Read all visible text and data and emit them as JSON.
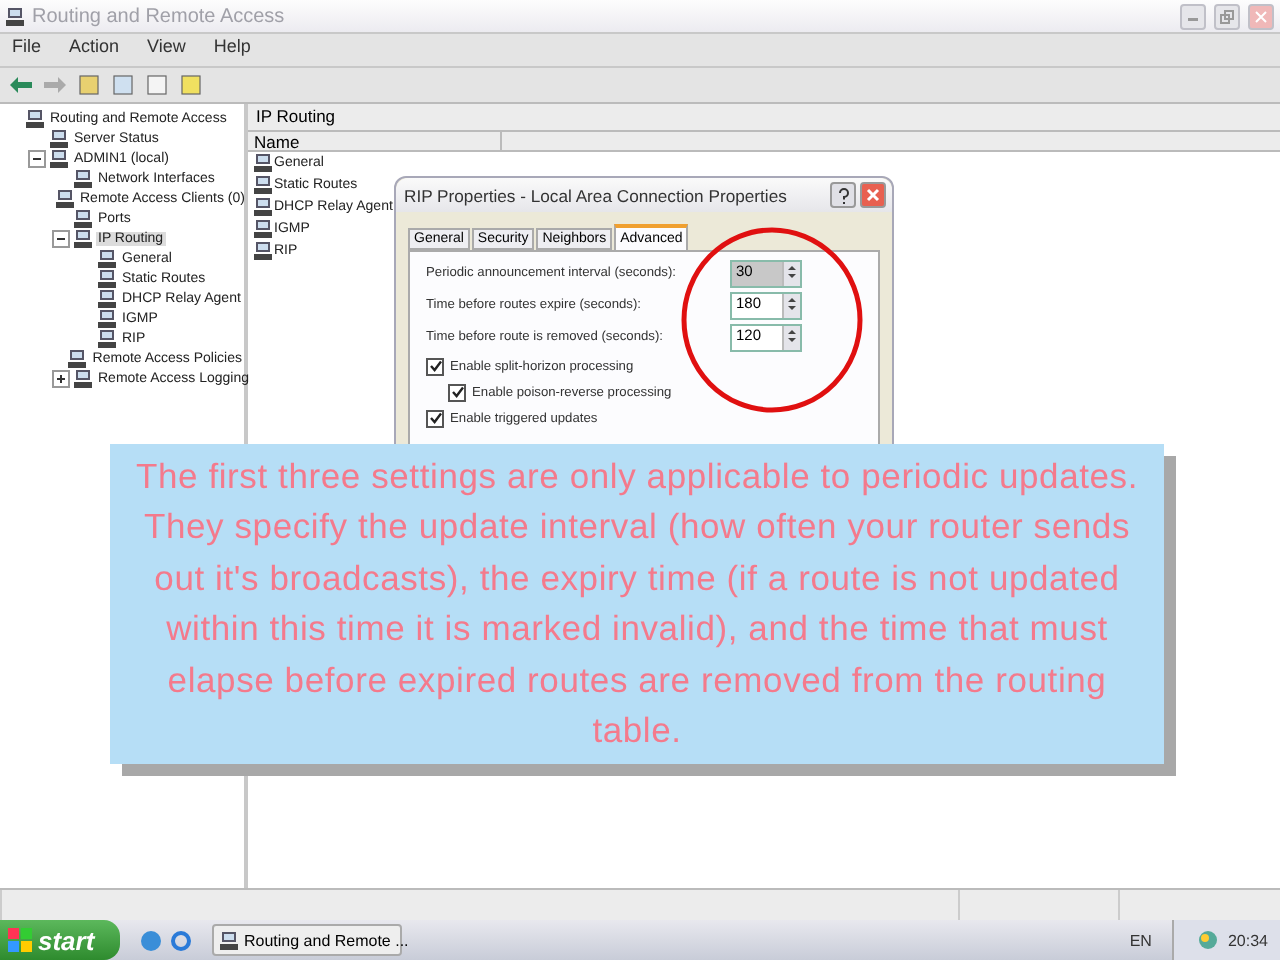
{
  "window": {
    "title": "Routing and Remote Access"
  },
  "menu": [
    "File",
    "Action",
    "View",
    "Help"
  ],
  "tree": [
    {
      "label": "Routing and Remote Access",
      "selected": false,
      "children": [
        {
          "label": "Server Status",
          "selected": false
        },
        {
          "label": "ADMIN1 (local)",
          "selected": false,
          "expanded": true,
          "children": [
            {
              "label": "Network Interfaces",
              "selected": false
            },
            {
              "label": "Remote Access Clients (0)",
              "selected": false
            },
            {
              "label": "Ports",
              "selected": false
            },
            {
              "label": "IP Routing",
              "selected": true,
              "expanded": true,
              "children": [
                {
                  "label": "General",
                  "selected": false
                },
                {
                  "label": "Static Routes",
                  "selected": false
                },
                {
                  "label": "DHCP Relay Agent",
                  "selected": false
                },
                {
                  "label": "IGMP",
                  "selected": false
                },
                {
                  "label": "RIP",
                  "selected": false
                }
              ]
            },
            {
              "label": "Remote Access Policies",
              "selected": false
            },
            {
              "label": "Remote Access Logging",
              "selected": false,
              "expanded": false
            }
          ]
        }
      ]
    }
  ],
  "pane": {
    "title": "IP Routing",
    "columns": [
      "Name"
    ],
    "items": [
      "General",
      "Static Routes",
      "DHCP Relay Agent",
      "IGMP",
      "RIP"
    ]
  },
  "dialog": {
    "title": "RIP Properties - Local Area Connection Properties",
    "tabs": [
      {
        "label": "General",
        "selected": false
      },
      {
        "label": "Security",
        "selected": false
      },
      {
        "label": "Neighbors",
        "selected": false
      },
      {
        "label": "Advanced",
        "selected": true
      }
    ],
    "fields": [
      {
        "label": "Periodic announcement interval (seconds):",
        "value": "30",
        "highlighted": true
      },
      {
        "label": "Time before routes expire (seconds):",
        "value": "180",
        "highlighted": false
      },
      {
        "label": "Time before route is removed (seconds):",
        "value": "120",
        "highlighted": false
      }
    ],
    "checkboxes": [
      {
        "label": "Enable split-horizon processing",
        "checked": true,
        "children": [
          {
            "label": "Enable poison-reverse processing",
            "checked": true
          }
        ]
      },
      {
        "label": "Enable triggered updates",
        "checked": true
      }
    ]
  },
  "callout": {
    "text": "The first three settings are only applicable to periodic updates. They specify the update interval (how often your router sends out it's broadcasts), the expiry time (if a route is not updated within this time it is marked invalid), and the time that must elapse before expired routes are removed from the routing table."
  },
  "taskbar": {
    "start": "start",
    "tasks": [
      "Routing and Remote ..."
    ],
    "language": "EN",
    "clock": "20:34"
  }
}
